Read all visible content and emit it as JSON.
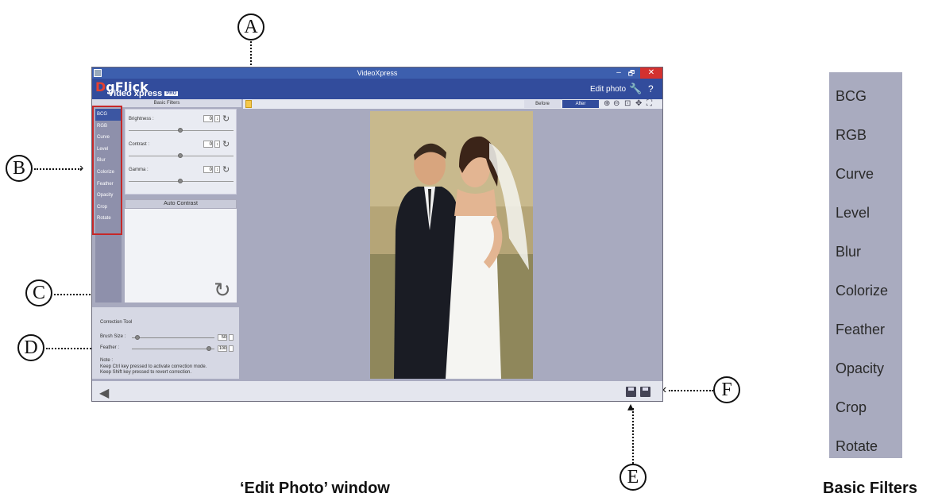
{
  "window": {
    "title": "VideoXpress",
    "controls": {
      "minimize": "–",
      "maximize": "🗗",
      "close": "✕"
    }
  },
  "header": {
    "logo_main_d": "D",
    "logo_main_rest": "gFlick",
    "logo_sub": "Video xpress",
    "logo_badge": "PRO",
    "edit_label": "Edit photo",
    "wrench_icon": "wrench-icon",
    "help_label": "?"
  },
  "left_panel": {
    "title": "Basic Filters",
    "filters": [
      "BCG",
      "RGB",
      "Curve",
      "Level",
      "Blur",
      "Colorize",
      "Feather",
      "Opacity",
      "Crop",
      "Rotate"
    ],
    "selected_filter": "BCG",
    "controls": [
      {
        "label": "Brightness :",
        "value": "0",
        "level": 0.5
      },
      {
        "label": "Contrast :",
        "value": "0",
        "level": 0.5
      },
      {
        "label": "Gamma :",
        "value": "0",
        "level": 0.5
      }
    ],
    "auto_contrast_label": "Auto Contrast"
  },
  "correction_tool": {
    "title": "Correction Tool",
    "brush_label": "Brush Size :",
    "brush_value": "50",
    "brush_level": 0.05,
    "feather_label": "Feather :",
    "feather_value": "100",
    "feather_level": 0.92,
    "note_title": "Note :",
    "note_line1": "Keep Ctrl key pressed to activate correction mode.",
    "note_line2": "Keep Shift key pressed to revert correction."
  },
  "toolbar": {
    "before_label": "Before",
    "after_label": "After",
    "icons": [
      "zoom-in-icon",
      "zoom-out-icon",
      "fit-icon",
      "move-icon",
      "fullscreen-icon"
    ]
  },
  "callouts": {
    "a": "A",
    "b": "B",
    "c": "C",
    "d": "D",
    "e": "E",
    "f": "F"
  },
  "captions": {
    "edit_photo": "‘Edit Photo’ window",
    "basic_filters": "Basic Filters"
  },
  "zoom_panel": {
    "filters": [
      "BCG",
      "RGB",
      "Curve",
      "Level",
      "Blur",
      "Colorize",
      "Feather",
      "Opacity",
      "Crop",
      "Rotate"
    ]
  },
  "colors": {
    "title_bar": "#3d5fae",
    "header": "#324c9c",
    "filter_list": "#8e90ab",
    "selected": "#3c56a2",
    "close": "#d3312f",
    "logo_accent": "#e8402e"
  }
}
